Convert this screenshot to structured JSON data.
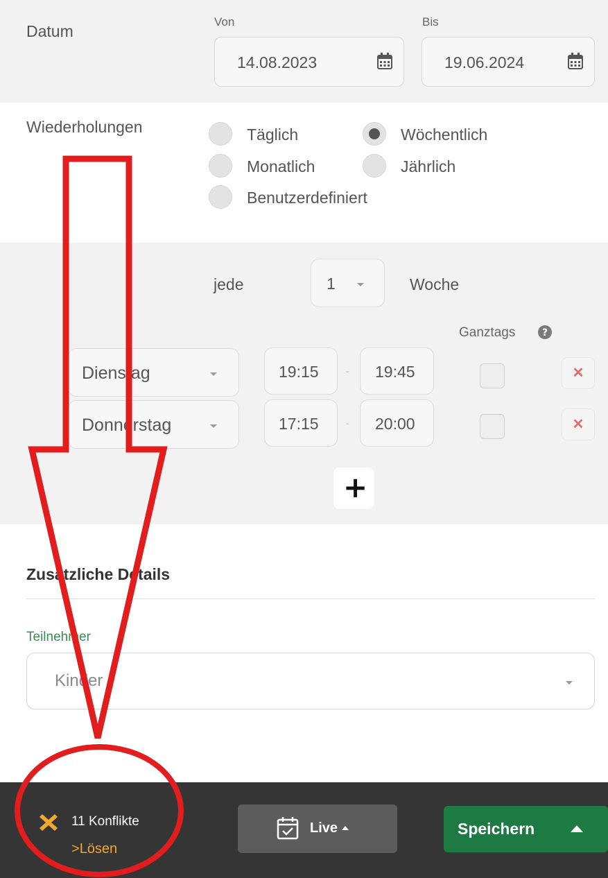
{
  "date": {
    "label": "Datum",
    "from_label": "Von",
    "from_value": "14.08.2023",
    "to_label": "Bis",
    "to_value": "19.06.2024"
  },
  "recurrence": {
    "label": "Wiederholungen",
    "options": [
      "Täglich",
      "Wöchentlich",
      "Monatlich",
      "Jährlich",
      "Benutzerdefiniert"
    ],
    "selected": "Wöchentlich"
  },
  "interval": {
    "prefix": "jede",
    "value": "1",
    "unit": "Woche"
  },
  "all_day_label": "Ganztags",
  "schedule": [
    {
      "day": "Dienstag",
      "start": "19:15",
      "separator": "-",
      "end": "19:45",
      "all_day": false
    },
    {
      "day": "Donnerstag",
      "start": "17:15",
      "separator": "-",
      "end": "20:00",
      "all_day": false
    }
  ],
  "add_label": "+",
  "details": {
    "heading": "Zusätzliche Details",
    "participants_label": "Teilnehmer",
    "participants_value": "Kinder"
  },
  "footer": {
    "conflicts_text": "11 Konflikte",
    "resolve_text": "Lösen",
    "live_label": "Live",
    "save_label": "Speichern"
  },
  "colors": {
    "accent_green": "#1d7a43",
    "label_green": "#3c8a55",
    "conflict_orange": "#f0a830",
    "annotation_red": "#e11d1d"
  },
  "icons": [
    "calendar-icon",
    "question-circle-icon",
    "close-icon",
    "plus-icon",
    "conflict-x-icon",
    "chevron-right-icon",
    "calendar-check-icon",
    "caret-up-icon",
    "caret-down-icon"
  ]
}
